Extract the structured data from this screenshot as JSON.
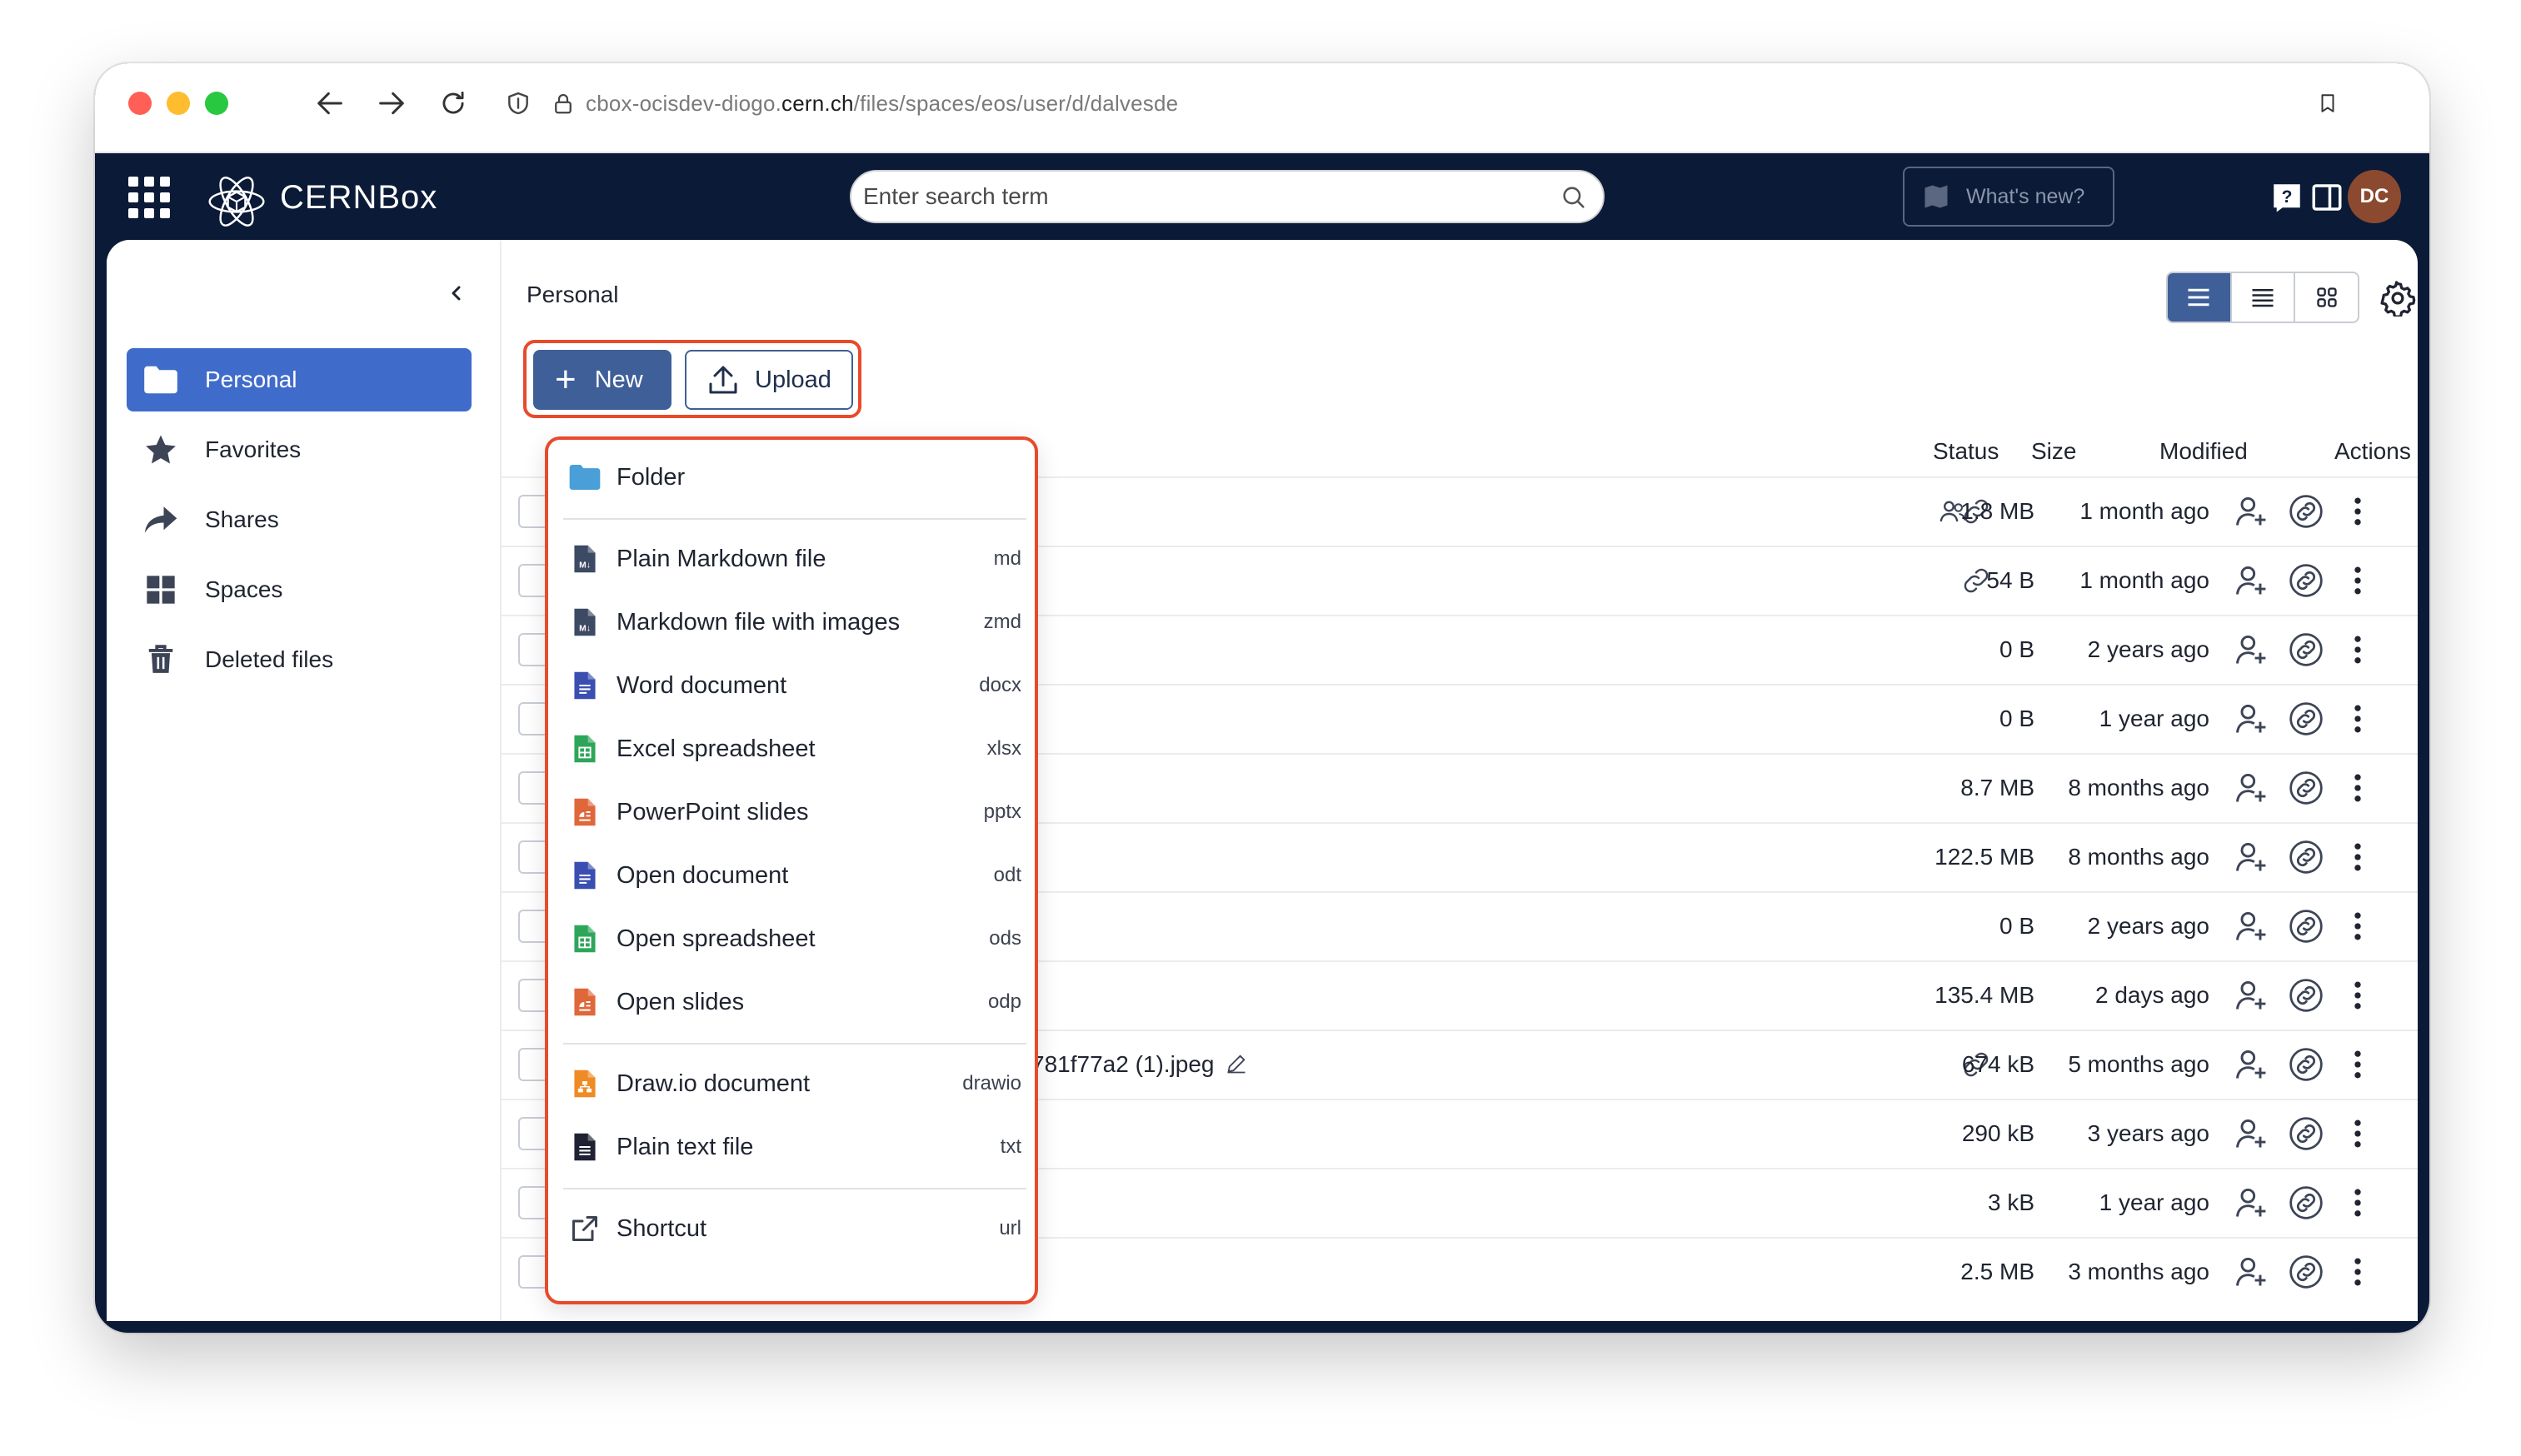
{
  "browser": {
    "url_prefix": "cbox-ocisdev-diogo.",
    "url_host": "cern.ch",
    "url_path": "/files/spaces/eos/user/d/dalvesde"
  },
  "header": {
    "brand": "CERNBox",
    "search_placeholder": "Enter search term",
    "whats_new": "What's new?",
    "avatar_initials": "DC"
  },
  "sidebar": {
    "items": [
      {
        "label": "Personal",
        "icon": "folder-icon"
      },
      {
        "label": "Favorites",
        "icon": "star-icon"
      },
      {
        "label": "Shares",
        "icon": "share-arrow-icon"
      },
      {
        "label": "Spaces",
        "icon": "spaces-grid-icon"
      },
      {
        "label": "Deleted files",
        "icon": "trash-icon"
      }
    ]
  },
  "main": {
    "breadcrumb": "Personal",
    "new_label": "New",
    "upload_label": "Upload",
    "columns": {
      "status": "Status",
      "size": "Size",
      "modified": "Modified",
      "actions": "Actions"
    },
    "rows": [
      {
        "name": "",
        "size": "1.8 MB",
        "modified": "1 month ago",
        "status": [
          "shared-users-icon",
          "link-icon"
        ]
      },
      {
        "name": "",
        "size": "54 B",
        "modified": "1 month ago",
        "status": [
          "link-icon"
        ]
      },
      {
        "name": "",
        "size": "0 B",
        "modified": "2 years ago",
        "status": []
      },
      {
        "name": "",
        "size": "0 B",
        "modified": "1 year ago",
        "status": []
      },
      {
        "name": "",
        "size": "8.7 MB",
        "modified": "8 months ago",
        "status": []
      },
      {
        "name": "",
        "size": "122.5 MB",
        "modified": "8 months ago",
        "status": []
      },
      {
        "name": "",
        "size": "0 B",
        "modified": "2 years ago",
        "status": []
      },
      {
        "name": "",
        "size": "135.4 MB",
        "modified": "2 days ago",
        "status": []
      },
      {
        "name": "781f77a2 (1).jpeg",
        "size": "674 kB",
        "modified": "5 months ago",
        "status": [
          "link-icon"
        ]
      },
      {
        "name": "",
        "size": "290 kB",
        "modified": "3 years ago",
        "status": []
      },
      {
        "name": "",
        "size": "3 kB",
        "modified": "1 year ago",
        "status": []
      },
      {
        "name": "",
        "size": "2.5 MB",
        "modified": "3 months ago",
        "status": []
      }
    ]
  },
  "new_menu": {
    "items": [
      {
        "label": "Folder",
        "ext": "",
        "icon": "folder-icon",
        "color": "#4a9fd8"
      },
      {
        "label": "Plain Markdown file",
        "ext": "md",
        "icon": "markdown-file-icon",
        "color": "#3d4a63"
      },
      {
        "label": "Markdown file with images",
        "ext": "zmd",
        "icon": "markdown-file-icon",
        "color": "#3d4a63"
      },
      {
        "label": "Word document",
        "ext": "docx",
        "icon": "word-file-icon",
        "color": "#3a4fb0"
      },
      {
        "label": "Excel spreadsheet",
        "ext": "xlsx",
        "icon": "spreadsheet-file-icon",
        "color": "#2ea65a"
      },
      {
        "label": "PowerPoint slides",
        "ext": "pptx",
        "icon": "slides-file-icon",
        "color": "#e0673a"
      },
      {
        "label": "Open document",
        "ext": "odt",
        "icon": "word-file-icon",
        "color": "#3a4fb0"
      },
      {
        "label": "Open spreadsheet",
        "ext": "ods",
        "icon": "spreadsheet-file-icon",
        "color": "#2ea65a"
      },
      {
        "label": "Open slides",
        "ext": "odp",
        "icon": "slides-file-icon",
        "color": "#e0673a"
      },
      {
        "label": "Draw.io document",
        "ext": "drawio",
        "icon": "drawio-file-icon",
        "color": "#f08a24"
      },
      {
        "label": "Plain text file",
        "ext": "txt",
        "icon": "text-file-icon",
        "color": "#1e2233"
      },
      {
        "label": "Shortcut",
        "ext": "url",
        "icon": "external-link-icon",
        "color": "#3c4250"
      }
    ]
  },
  "colors": {
    "accent": "#3f6ccb",
    "primary_btn": "#3f5f98",
    "header_bg": "#0b1a37",
    "highlight": "#e84a2c"
  }
}
